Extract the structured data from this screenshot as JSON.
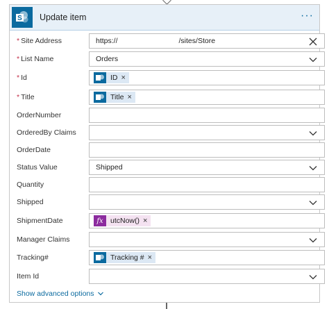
{
  "card": {
    "title": "Update item",
    "more_icon": "ellipsis-icon",
    "more_label": "···"
  },
  "fields": {
    "site_address": {
      "label": "Site Address",
      "required": "*",
      "value_prefix": "https://",
      "value_suffix": "/sites/Store"
    },
    "list_name": {
      "label": "List Name",
      "required": "*",
      "value": "Orders"
    },
    "id": {
      "label": "Id",
      "required": "*",
      "token": "ID"
    },
    "title": {
      "label": "Title",
      "required": "*",
      "token": "Title"
    },
    "order_number": {
      "label": "OrderNumber"
    },
    "ordered_by_claims": {
      "label": "OrderedBy Claims"
    },
    "order_date": {
      "label": "OrderDate"
    },
    "status_value": {
      "label": "Status Value",
      "value": "Shipped"
    },
    "quantity": {
      "label": "Quantity"
    },
    "shipped": {
      "label": "Shipped"
    },
    "shipment_date": {
      "label": "ShipmentDate",
      "token": "utcNow()",
      "token_icon_text": "fx"
    },
    "manager_claims": {
      "label": "Manager Claims"
    },
    "tracking": {
      "label": "Tracking#",
      "token": "Tracking #"
    },
    "item_id": {
      "label": "Item Id"
    }
  },
  "remove_glyph": "×",
  "advanced": {
    "label": "Show advanced options"
  },
  "colors": {
    "brand": "#0b6a9f",
    "header_bg": "#e7f0f8",
    "required": "#c4314b",
    "token_bg": "#dce8f4",
    "fx": "#8c2b9e"
  }
}
